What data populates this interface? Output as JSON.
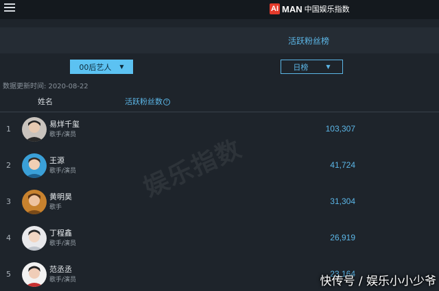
{
  "brand": {
    "badge": "AI",
    "wordmark": "MAN",
    "title_cn": "中国娱乐指数"
  },
  "header": {
    "menu_icon": "hamburger-menu-icon",
    "page_title": "活跃粉丝榜"
  },
  "filters": {
    "category": {
      "selected": "00后艺人"
    },
    "period": {
      "selected": "日榜"
    }
  },
  "update_time": "数据更新时间: 2020-08-22",
  "columns": {
    "name": "姓名",
    "fans": "活跃粉丝数"
  },
  "colors": {
    "accent": "#5cb7e8",
    "select_fill": "#5cc2f2",
    "background": "#1e242b",
    "brand_red": "#e43b2c"
  },
  "rows": [
    {
      "rank": "1",
      "name": "易烊千玺",
      "role": "歌手/演员",
      "value": "103,307"
    },
    {
      "rank": "2",
      "name": "王源",
      "role": "歌手/演员",
      "value": "41,724"
    },
    {
      "rank": "3",
      "name": "黄明昊",
      "role": "歌手",
      "value": "31,304"
    },
    {
      "rank": "4",
      "name": "丁程鑫",
      "role": "歌手/演员",
      "value": "26,919"
    },
    {
      "rank": "5",
      "name": "范丞丞",
      "role": "歌手/演员",
      "value": "23,164"
    }
  ],
  "watermark": "娱乐指数",
  "source_tag": "快传号 / 娱乐小小少爷"
}
